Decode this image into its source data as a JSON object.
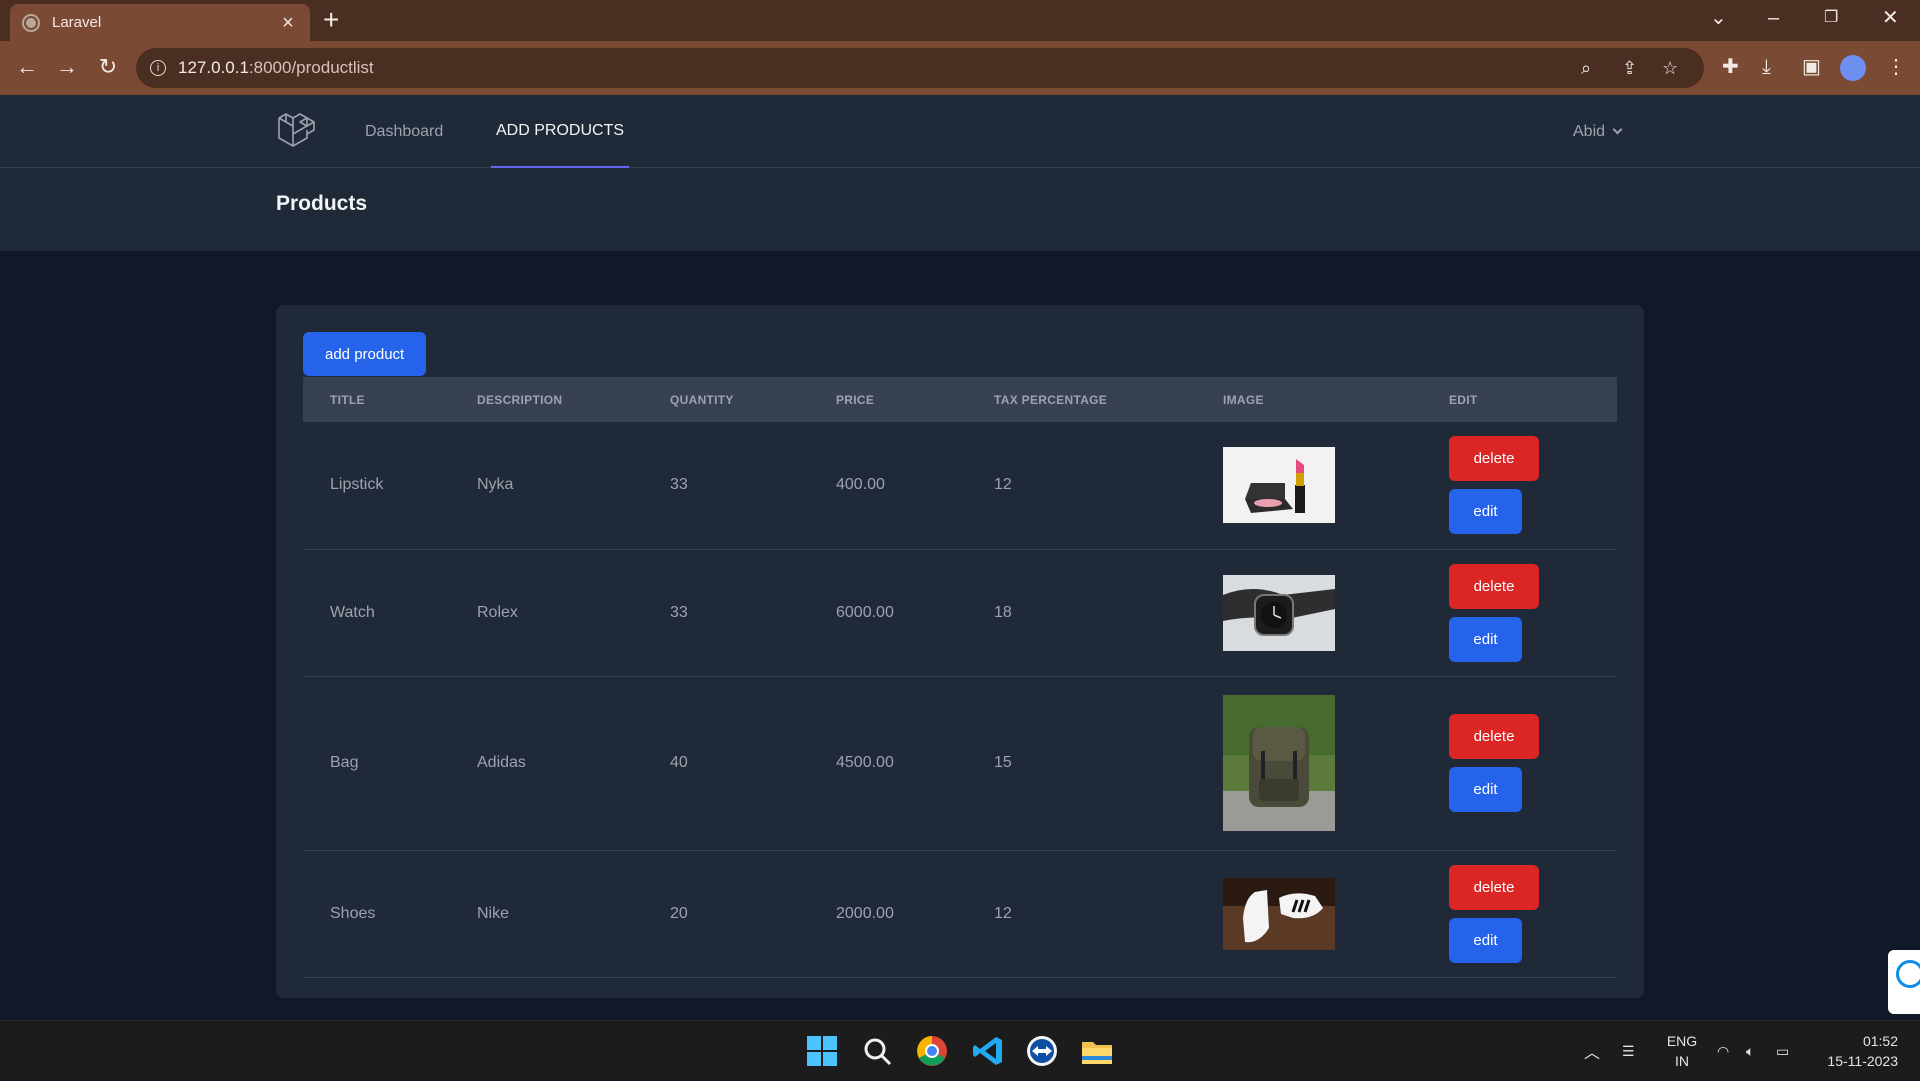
{
  "browser": {
    "tab_title": "Laravel",
    "url_host": "127.0.0.1",
    "url_path": ":8000/productlist"
  },
  "nav": {
    "dashboard": "Dashboard",
    "add_products": "ADD PRODUCTS",
    "user": "Abid"
  },
  "header": {
    "title": "Products"
  },
  "add_button": "add product",
  "columns": [
    "TITLE",
    "DESCRIPTION",
    "QUANTITY",
    "PRICE",
    "TAX PERCENTAGE",
    "IMAGE",
    "EDIT"
  ],
  "products": [
    {
      "title": "Lipstick",
      "description": "Nyka",
      "quantity": "33",
      "price": "400.00",
      "tax": "12",
      "image": "lipstick-image"
    },
    {
      "title": "Watch",
      "description": "Rolex",
      "quantity": "33",
      "price": "6000.00",
      "tax": "18",
      "image": "watch-image"
    },
    {
      "title": "Bag",
      "description": "Adidas",
      "quantity": "40",
      "price": "4500.00",
      "tax": "15",
      "image": "bag-image"
    },
    {
      "title": "Shoes",
      "description": "Nike",
      "quantity": "20",
      "price": "2000.00",
      "tax": "12",
      "image": "shoes-image"
    }
  ],
  "actions": {
    "delete": "delete",
    "edit": "edit"
  },
  "taskbar": {
    "lang_top": "ENG",
    "lang_bottom": "IN",
    "time": "01:52",
    "date": "15-11-2023"
  },
  "colors": {
    "accent": "#2563eb",
    "danger": "#dc2626",
    "nav_bg": "#1f2937",
    "page_bg": "#111827"
  }
}
